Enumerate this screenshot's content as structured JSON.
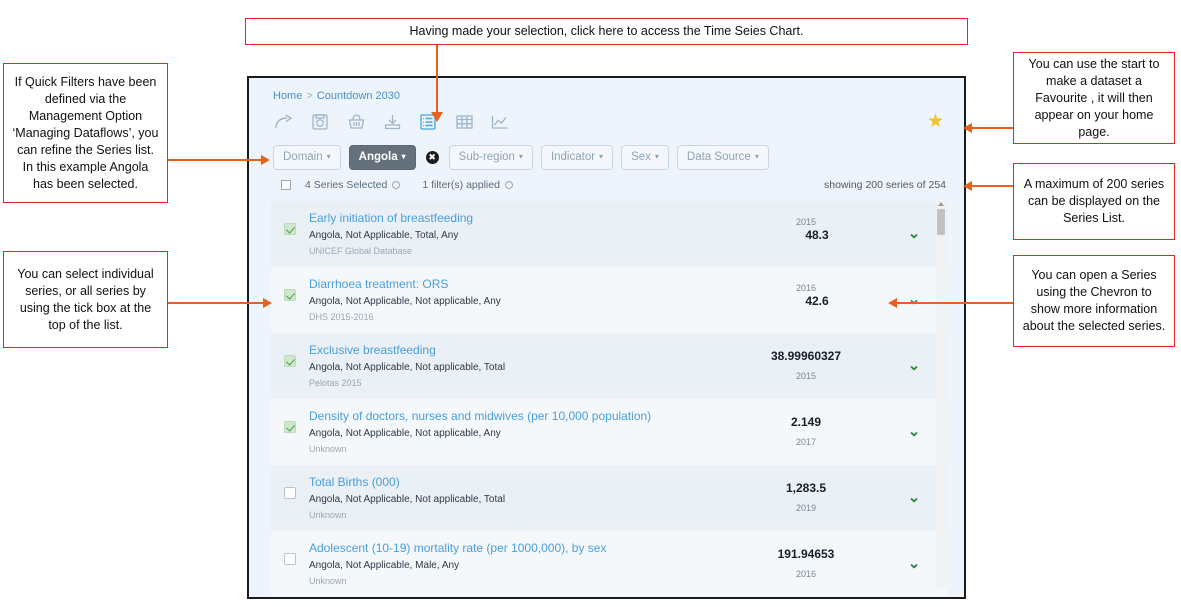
{
  "annotations": [
    {
      "id": "quick-filters",
      "text": "If Quick Filters have been defined via the Management Option ‘Managing Dataflows’, you can refine the Series list. In this example Angola has been selected."
    },
    {
      "id": "select-series",
      "text": "You can select individual series, or all series by using the tick box at the top of the list."
    },
    {
      "id": "time-series-chart",
      "text": "Having made your selection, click here to access the Time Seies Chart."
    },
    {
      "id": "favourite-star",
      "text": "You can use the start to make a dataset a Favourite , it will then appear on your home page."
    },
    {
      "id": "max-series",
      "text": "A maximum of 200 series can be displayed on the Series List."
    },
    {
      "id": "open-series-chevron",
      "text": "You can open a Series using the Chevron to show more information about the selected series."
    }
  ],
  "app": {
    "breadcrumb": {
      "home": "Home",
      "separator": ">",
      "current": "Countdown 2030"
    },
    "toolbar": {
      "icons": [
        {
          "name": "share-icon",
          "label": "Share"
        },
        {
          "name": "save-icon",
          "label": "Save"
        },
        {
          "name": "basket-icon",
          "label": "Basket"
        },
        {
          "name": "download-icon",
          "label": "Download"
        },
        {
          "name": "list-view-icon",
          "label": "List view"
        },
        {
          "name": "table-view-icon",
          "label": "Table view"
        },
        {
          "name": "time-series-chart-icon",
          "label": "Time Series Chart"
        }
      ],
      "favourite_star": "★"
    },
    "filters": {
      "domain": "Domain",
      "country": "Angola",
      "clear": "✖",
      "subregion": "Sub-region",
      "indicator": "Indicator",
      "sex": "Sex",
      "datasource": "Data Source",
      "caret": "▾"
    },
    "status": {
      "series_selected": "4 Series Selected",
      "filters_applied": "1 filter(s) applied",
      "showing": "showing 200 series of 254"
    },
    "series": [
      {
        "title": "Early initiation of breastfeeding",
        "dimensions": "Angola, Not Applicable, Total, Any",
        "source": "UNICEF Global Database",
        "year_top": "2015",
        "value": "48.3",
        "year_bottom": "",
        "checked": true,
        "chevron": "⌄",
        "value_layout": "year-above"
      },
      {
        "title": "Diarrhoea treatment: ORS",
        "dimensions": "Angola, Not Applicable, Not applicable, Any",
        "source": "DHS 2015-2016",
        "year_top": "2016",
        "value": "42.6",
        "year_bottom": "",
        "checked": true,
        "chevron": "⌄",
        "value_layout": "year-above"
      },
      {
        "title": "Exclusive breastfeeding",
        "dimensions": "Angola, Not Applicable, Not applicable, Total",
        "source": "Pelotas 2015",
        "year_top": "",
        "value": "38.99960327",
        "year_bottom": "2015",
        "checked": true,
        "chevron": "⌄",
        "value_layout": "year-below"
      },
      {
        "title": "Density of doctors, nurses and midwives (per 10,000 population)",
        "dimensions": "Angola, Not Applicable, Not applicable, Any",
        "source": "Unknown",
        "year_top": "",
        "value": "2.149",
        "year_bottom": "2017",
        "checked": true,
        "chevron": "⌄",
        "value_layout": "year-below"
      },
      {
        "title": "Total Births (000)",
        "dimensions": "Angola, Not Applicable, Not applicable, Total",
        "source": "Unknown",
        "year_top": "",
        "value": "1,283.5",
        "year_bottom": "2019",
        "checked": false,
        "chevron": "⌄",
        "value_layout": "year-below"
      },
      {
        "title": "Adolescent (10-19) mortality rate (per 1000,000), by sex",
        "dimensions": "Angola, Not Applicable, Male, Any",
        "source": "Unknown",
        "year_top": "",
        "value": "191.94653",
        "year_bottom": "2016",
        "checked": false,
        "chevron": "⌄",
        "value_layout": "year-below"
      }
    ]
  },
  "colors": {
    "annotation_border": "#e8251f",
    "connector": "#e8601c",
    "panel_bg": "#eef4fb",
    "link": "#4a9fdc",
    "selected_filter_bg": "#64717d",
    "star": "#f2c230",
    "chevron": "#2f8a3f"
  }
}
